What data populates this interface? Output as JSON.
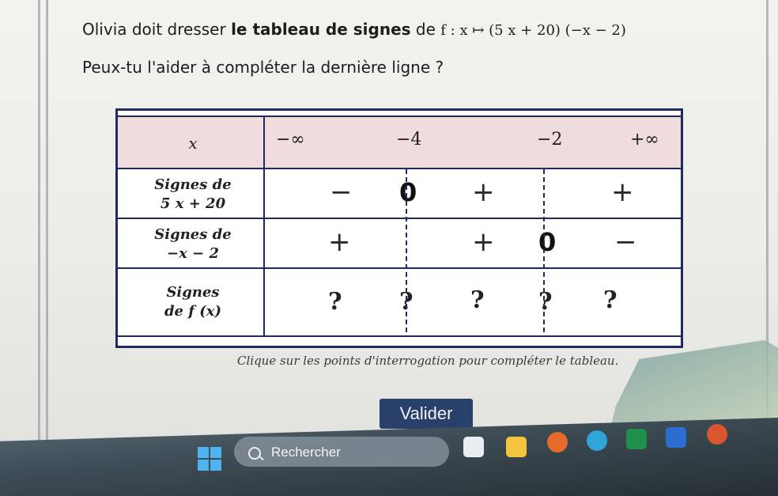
{
  "question": {
    "prefix": "Olivia doit dresser ",
    "bold": "le tableau de signes",
    "middle": " de ",
    "function": "f : x ↦ (5 x + 20) (−x − 2)"
  },
  "subquestion": "Peux-tu l'aider à compléter la dernière ligne ?",
  "table": {
    "header_label": "x",
    "header_values": [
      "−∞",
      "−4",
      "−2",
      "+∞"
    ],
    "row1": {
      "label_line1": "Signes de",
      "label_line2": "5 x + 20",
      "signs": [
        "−",
        "0",
        "+",
        "+"
      ]
    },
    "row2": {
      "label_line1": "Signes de",
      "label_line2": "−x − 2",
      "signs": [
        "+",
        "+",
        "0",
        "−"
      ]
    },
    "row3": {
      "label_line1": "Signes",
      "label_line2": "de f (x)",
      "marks": [
        "?",
        "?",
        "?",
        "?",
        "?"
      ]
    }
  },
  "hint": "Clique sur les points d'interrogation pour compléter le tableau.",
  "valider_label": "Valider",
  "taskbar": {
    "search_placeholder": "Rechercher",
    "icons": [
      "windows-start-icon",
      "search-icon",
      "task-view-icon",
      "file-explorer-icon",
      "firefox-icon",
      "edge-icon",
      "excel-icon",
      "word-icon",
      "powerpoint-icon"
    ]
  },
  "colors": {
    "table_border": "#1e2a60",
    "header_fill": "#f0dcdc",
    "valider_button": "#29416a"
  }
}
